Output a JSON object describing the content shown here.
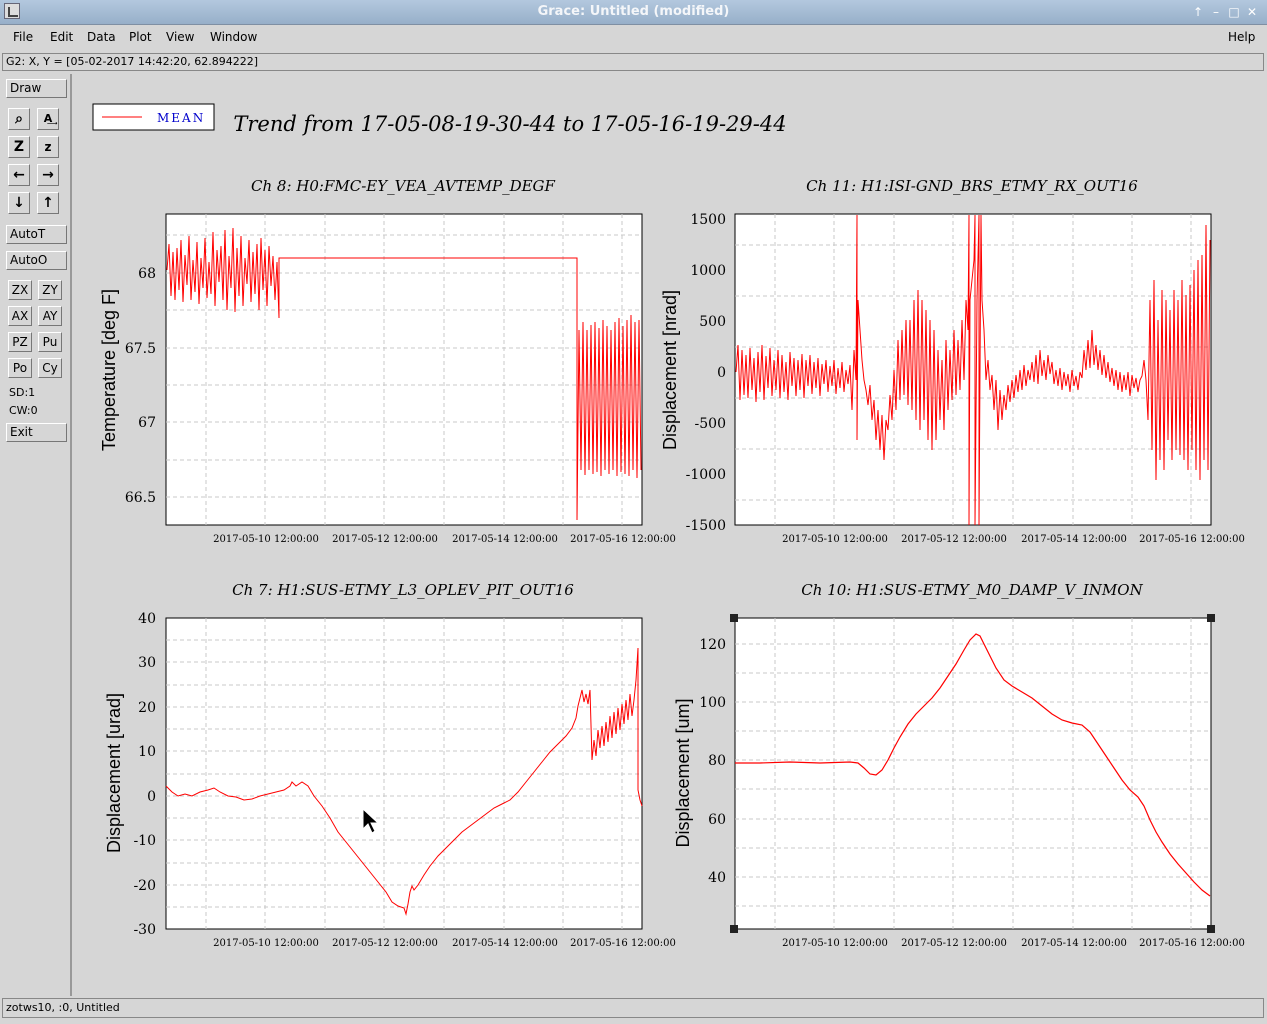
{
  "window": {
    "title": "Grace: Untitled (modified)"
  },
  "menu": [
    "File",
    "Edit",
    "Data",
    "Plot",
    "View",
    "Window"
  ],
  "help": "Help",
  "coord_readout": "G2: X, Y = [05-02-2017 14:42:20, 62.894222]",
  "tools": {
    "draw": "Draw",
    "icons": [
      "zoom-icon",
      "autoscale-text-icon",
      "zoom-in-icon",
      "zoom-out-icon",
      "pan-left-icon",
      "pan-right-icon",
      "pan-down-icon",
      "pan-up-icon"
    ],
    "autot": "AutoT",
    "autoo": "AutoO",
    "small": [
      "ZX",
      "ZY",
      "AX",
      "AY",
      "PZ",
      "Pu",
      "Po",
      "Cy"
    ],
    "sd": "SD:1",
    "cw": "CW:0",
    "exit": "Exit"
  },
  "legend": {
    "label": "MEAN",
    "color": "#ff0000"
  },
  "title": "Trend from 17-05-08-19-30-44 to 17-05-16-19-29-44",
  "status": "zotws10, :0, Untitled",
  "xticks": [
    "2017-05-10 12:00:00",
    "2017-05-12 12:00:00",
    "2017-05-14 12:00:00",
    "2017-05-16 12:00:00"
  ],
  "plots": [
    {
      "title": "Ch 8: H0:FMC-EY_VEA_AVTEMP_DEGF",
      "ylabel": "Temperature [deg F]",
      "yticks": [
        "68",
        "67.5",
        "67",
        "66.5"
      ]
    },
    {
      "title": "Ch 11: H1:ISI-GND_BRS_ETMY_RX_OUT16",
      "ylabel": "Displacement [nrad]",
      "yticks": [
        "1500",
        "1000",
        "500",
        "0",
        "-500",
        "-1000",
        "-1500"
      ]
    },
    {
      "title": "Ch 7: H1:SUS-ETMY_L3_OPLEV_PIT_OUT16",
      "ylabel": "Displacement [urad]",
      "yticks": [
        "40",
        "30",
        "20",
        "10",
        "0",
        "-10",
        "-20",
        "-30"
      ]
    },
    {
      "title": "Ch 10: H1:SUS-ETMY_M0_DAMP_V_INMON",
      "ylabel": "Displacement [um]",
      "yticks": [
        "120",
        "100",
        "80",
        "60",
        "40"
      ]
    }
  ],
  "chart_data": [
    {
      "type": "line",
      "title": "Ch 8: H0:FMC-EY_VEA_AVTEMP_DEGF",
      "ylabel": "Temperature [deg F]",
      "ylim": [
        66.4,
        68.4
      ],
      "x": [
        "2017-05-09",
        "2017-05-10",
        "2017-05-10 12:00",
        "2017-05-15 12:00",
        "2017-05-15 18:00",
        "2017-05-16 19:00"
      ],
      "series": [
        {
          "name": "MEAN",
          "values": [
            68.0,
            67.95,
            68.11,
            68.11,
            66.35,
            66.9
          ]
        }
      ]
    },
    {
      "type": "line",
      "title": "Ch 11: H1:ISI-GND_BRS_ETMY_RX_OUT16",
      "ylabel": "Displacement [nrad]",
      "ylim": [
        -1500,
        1500
      ],
      "x": [
        "2017-05-09",
        "2017-05-11",
        "2017-05-11 12:00",
        "2017-05-12 12:00",
        "2017-05-13",
        "2017-05-14 12:00",
        "2017-05-15 12:00",
        "2017-05-16 19:00"
      ],
      "series": [
        {
          "name": "MEAN",
          "values": [
            0,
            0,
            -500,
            -300,
            300,
            -150,
            -100,
            0
          ]
        }
      ]
    },
    {
      "type": "line",
      "title": "Ch 7: H1:SUS-ETMY_L3_OPLEV_PIT_OUT16",
      "ylabel": "Displacement [urad]",
      "ylim": [
        -30,
        40
      ],
      "x": [
        "2017-05-08 20:00",
        "2017-05-09 12:00",
        "2017-05-10",
        "2017-05-11 12:00",
        "2017-05-12 12:00",
        "2017-05-13",
        "2017-05-14 12:00",
        "2017-05-15 12:00",
        "2017-05-16 19:00"
      ],
      "series": [
        {
          "name": "MEAN",
          "values": [
            2,
            1,
            0,
            2,
            -25,
            -15,
            -3,
            15,
            22
          ]
        }
      ]
    },
    {
      "type": "line",
      "title": "Ch 10: H1:SUS-ETMY_M0_DAMP_V_INMON",
      "ylabel": "Displacement [um]",
      "ylim": [
        25,
        130
      ],
      "x": [
        "2017-05-08 20:00",
        "2017-05-11",
        "2017-05-11 06:00",
        "2017-05-12",
        "2017-05-12 12:00",
        "2017-05-13 06:00",
        "2017-05-14 12:00",
        "2017-05-15 12:00",
        "2017-05-16 19:00"
      ],
      "series": [
        {
          "name": "MEAN",
          "values": [
            79,
            79,
            75,
            95,
            123,
            105,
            91,
            70,
            34
          ]
        }
      ]
    }
  ]
}
